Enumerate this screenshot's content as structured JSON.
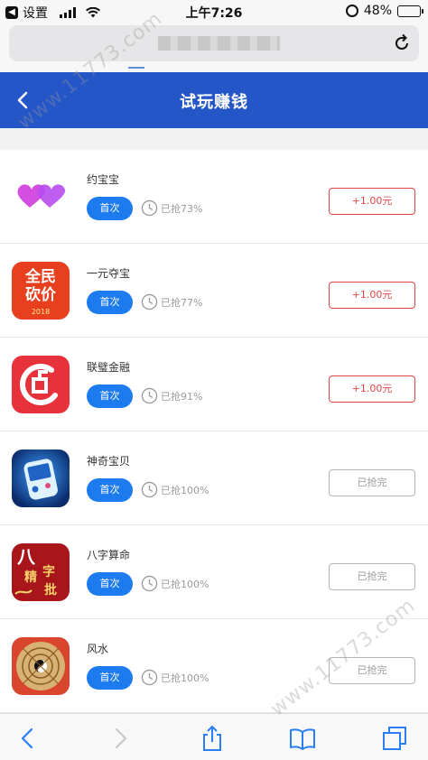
{
  "status_bar": {
    "back_app": "设置",
    "time": "上午7:26",
    "battery": "48%",
    "battery_level": 0.48
  },
  "header": {
    "title": "试玩赚钱"
  },
  "apps": [
    {
      "name": "约宝宝",
      "tag": "首次",
      "progress": "已抢73%",
      "reward": "+1.00元",
      "done": false,
      "icon": "hearts-icon"
    },
    {
      "name": "一元夺宝",
      "tag": "首次",
      "progress": "已抢77%",
      "reward": "+1.00元",
      "done": false,
      "icon": "quanmin-kanjia-icon",
      "icon_text": [
        "全民",
        "砍价",
        "2018"
      ]
    },
    {
      "name": "联璧金融",
      "tag": "首次",
      "progress": "已抢91%",
      "reward": "+1.00元",
      "done": false,
      "icon": "lianbi-logo-icon"
    },
    {
      "name": "神奇宝贝",
      "tag": "首次",
      "progress": "已抢100%",
      "reward": "已抢完",
      "done": true,
      "icon": "game-console-icon"
    },
    {
      "name": "八字算命",
      "tag": "首次",
      "progress": "已抢100%",
      "reward": "已抢完",
      "done": true,
      "icon": "bazi-icon",
      "icon_text": [
        "八",
        "精",
        "字",
        "批"
      ]
    },
    {
      "name": "风水",
      "tag": "首次",
      "progress": "已抢100%",
      "reward": "已抢完",
      "done": true,
      "icon": "compass-icon"
    }
  ],
  "watermark": [
    "www.11773.com",
    "www.11773.com"
  ],
  "colors": {
    "header": "#2556c8",
    "first_button": "#1d7bf0",
    "reward_active": "#e04848",
    "reward_done": "#9a9a9a"
  }
}
